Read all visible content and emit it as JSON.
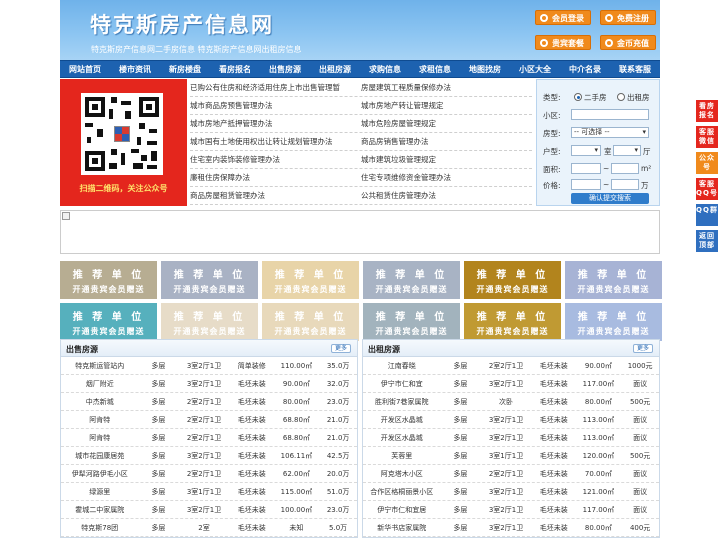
{
  "header": {
    "title": "特克斯房产信息网",
    "subtitle": "特克斯房产信息网二手房信息    特克斯房产信息网出租房信息",
    "buttons": [
      "会员登录",
      "免费注册",
      "贵宾套餐",
      "金币充值"
    ]
  },
  "nav": [
    "网站首页",
    "楼市资讯",
    "新房楼盘",
    "看房报名",
    "出售房源",
    "出租房源",
    "求购信息",
    "求租信息",
    "地图找房",
    "小区大全",
    "中介名录",
    "联系客服"
  ],
  "qr": {
    "caption": "扫描二维码，关注公众号"
  },
  "links": [
    [
      "已购公有住房和经济适用住房上市出售管理暂",
      "房屋建筑工程质量保修办法"
    ],
    [
      "城市商品房预售管理办法",
      "城市房地产转让管理规定"
    ],
    [
      "城市房地产抵押管理办法",
      "城市危险房屋管理规定"
    ],
    [
      "城市国有土地使用权出让转让规划管理办法",
      "商品房销售管理办法"
    ],
    [
      "住宅室内装饰装修管理办法",
      "城市建筑垃圾管理规定"
    ],
    [
      "廉租住房保障办法",
      "住宅专项维修资金管理办法"
    ],
    [
      "商品房屋租赁管理办法",
      "公共租赁住房管理办法"
    ]
  ],
  "search": {
    "type_label": "类型:",
    "type_options": [
      "二手房",
      "出租房"
    ],
    "community_label": "小区:",
    "community_value": "",
    "house_type_label": "房型:",
    "house_type_value": "-- 可选择 --",
    "layout_label": "户型:",
    "room_unit": "室",
    "hall_unit": "厅",
    "area_label": "面积:",
    "area_unit": "m²",
    "price_label": "价格:",
    "price_unit": "万",
    "tilde": "~",
    "submit": "确认提交搜索"
  },
  "tiles": {
    "line1": "推 荐 单 位",
    "line2": "开通贵宾会员赠送",
    "colors": [
      "#b7ad92",
      "#a9b2c4",
      "#e8d4a8",
      "#a8b3c4",
      "#b2841d",
      "#a7b3d5",
      "#56b0bd",
      "#e7dcc8",
      "#e8d9bb",
      "#a2b3bd",
      "#c09a33",
      "#a8bbe0"
    ]
  },
  "sale": {
    "title": "出售房源",
    "more": "更多",
    "rows": [
      [
        "特克斯运管站内",
        "多层",
        "3室2厅1卫",
        "简单装修",
        "110.00㎡",
        "35.0万"
      ],
      [
        "烟厂附近",
        "多层",
        "3室2厅1卫",
        "毛坯未装",
        "90.00㎡",
        "32.0万"
      ],
      [
        "中杰新城",
        "多层",
        "2室2厅1卫",
        "毛坯未装",
        "80.00㎡",
        "23.0万"
      ],
      [
        "阿肯特",
        "多层",
        "2室2厅1卫",
        "毛坯未装",
        "68.80㎡",
        "21.0万"
      ],
      [
        "阿肯特",
        "多层",
        "2室2厅1卫",
        "毛坯未装",
        "68.80㎡",
        "21.0万"
      ],
      [
        "城市花园康居苑",
        "多层",
        "3室2厅1卫",
        "毛坯未装",
        "106.11㎡",
        "42.5万"
      ],
      [
        "伊犁河路伊毛小区",
        "多层",
        "2室2厅1卫",
        "毛坯未装",
        "62.00㎡",
        "20.0万"
      ],
      [
        "绿源里",
        "多层",
        "3室1厅1卫",
        "毛坯未装",
        "115.00㎡",
        "51.0万"
      ],
      [
        "霍城二中家属院",
        "多层",
        "3室2厅1卫",
        "毛坯未装",
        "100.00㎡",
        "23.0万"
      ],
      [
        "特克斯78团",
        "多层",
        "2室",
        "毛坯未装",
        "未知",
        "5.0万"
      ]
    ]
  },
  "rent": {
    "title": "出租房源",
    "more": "更多",
    "rows": [
      [
        "江南春晓",
        "多层",
        "2室2厅1卫",
        "毛坯未装",
        "90.00㎡",
        "1000元"
      ],
      [
        "伊宁市仁和宜",
        "多层",
        "3室2厅1卫",
        "毛坯未装",
        "117.00㎡",
        "面议"
      ],
      [
        "胜利街7巷家属院",
        "多层",
        "次卧",
        "毛坯未装",
        "80.00㎡",
        "500元"
      ],
      [
        "开发区水晶城",
        "多层",
        "3室2厅1卫",
        "毛坯未装",
        "113.00㎡",
        "面议"
      ],
      [
        "开发区水晶城",
        "多层",
        "3室2厅1卫",
        "毛坯未装",
        "113.00㎡",
        "面议"
      ],
      [
        "芙蓉里",
        "多层",
        "3室1厅1卫",
        "毛坯未装",
        "120.00㎡",
        "500元"
      ],
      [
        "阿克塔木小区",
        "多层",
        "2室2厅1卫",
        "毛坯未装",
        "70.00㎡",
        "面议"
      ],
      [
        "合作区格桐丽景小区",
        "多层",
        "3室2厅1卫",
        "毛坯未装",
        "121.00㎡",
        "面议"
      ],
      [
        "伊宁市仁和宜居",
        "多层",
        "3室2厅1卫",
        "毛坯未装",
        "117.00㎡",
        "面议"
      ],
      [
        "新华书店家属院",
        "多层",
        "3室2厅1卫",
        "毛坯未装",
        "80.00㎡",
        "400元"
      ]
    ]
  },
  "float": [
    "看房报名",
    "客服微信",
    "公众号",
    "客服QQ号",
    "QQ群",
    "返回顶部"
  ]
}
